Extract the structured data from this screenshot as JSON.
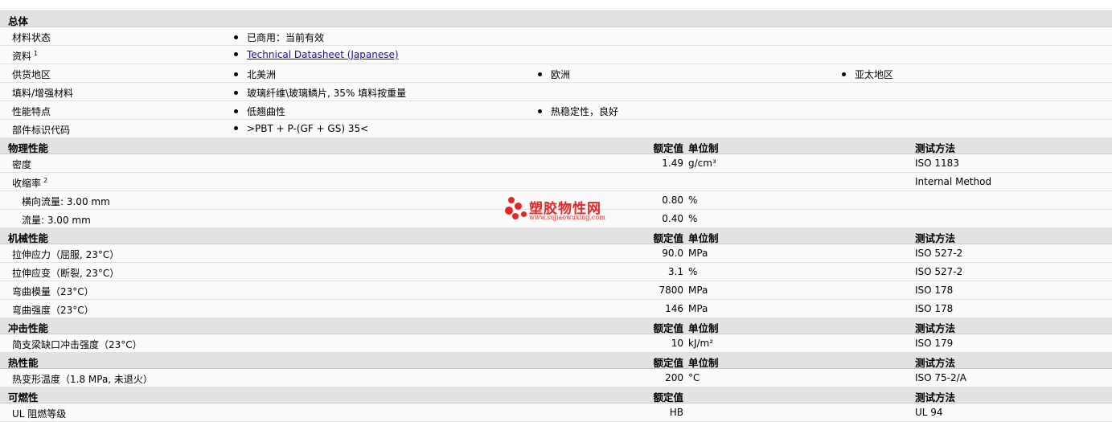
{
  "general": {
    "title": "总体",
    "rows": {
      "status": {
        "label": "材料状态",
        "value": "已商用：当前有效"
      },
      "docs": {
        "label": "资料",
        "note": "1",
        "link": "Technical Datasheet (Japanese)"
      },
      "supply": {
        "label": "供货地区",
        "values": [
          "北美洲",
          "欧洲",
          "亚太地区"
        ]
      },
      "filler": {
        "label": "填料/增强材料",
        "value": "玻璃纤维\\玻璃鳞片, 35% 填料按重量"
      },
      "features": {
        "label": "性能特点",
        "values": [
          "低翘曲性",
          "热稳定性，良好"
        ]
      },
      "partcode": {
        "label": "部件标识代码",
        "value": ">PBT + P-(GF + GS) 35<"
      }
    }
  },
  "headers": {
    "nominal": "额定值",
    "unit": "单位制",
    "method": "测试方法"
  },
  "physical": {
    "title": "物理性能",
    "density": {
      "label": "密度",
      "value": "1.49",
      "unit": "g/cm³",
      "method": "ISO 1183"
    },
    "shrink": {
      "label": "收缩率",
      "note": "2",
      "method": "Internal Method"
    },
    "shrink_cross": {
      "label": "横向流量: 3.00 mm",
      "value": "0.80",
      "unit": "%"
    },
    "shrink_flow": {
      "label": "流量: 3.00 mm",
      "value": "0.40",
      "unit": "%"
    }
  },
  "mechanical": {
    "title": "机械性能",
    "rows": [
      {
        "label": "拉伸应力（屈服, 23°C）",
        "value": "90.0",
        "unit": "MPa",
        "method": "ISO 527-2"
      },
      {
        "label": "拉伸应变（断裂, 23°C）",
        "value": "3.1",
        "unit": "%",
        "method": "ISO 527-2"
      },
      {
        "label": "弯曲模量（23°C）",
        "value": "7800",
        "unit": "MPa",
        "method": "ISO 178"
      },
      {
        "label": "弯曲强度（23°C）",
        "value": "146",
        "unit": "MPa",
        "method": "ISO 178"
      }
    ]
  },
  "impact": {
    "title": "冲击性能",
    "row": {
      "label": "简支梁缺口冲击强度（23°C）",
      "value": "10",
      "unit": "kJ/m²",
      "method": "ISO 179"
    }
  },
  "thermal": {
    "title": "热性能",
    "row": {
      "label": "热变形温度（1.8 MPa, 未退火）",
      "value": "200",
      "unit": "°C",
      "method": "ISO 75-2/A"
    }
  },
  "flammability": {
    "title": "可燃性",
    "row": {
      "label": "UL 阻燃等级",
      "value": "HB",
      "method": "UL 94"
    }
  },
  "watermark": {
    "name": "塑胶物性网",
    "url": "www.sujiaowuxing.com",
    "color": "#e52626"
  }
}
